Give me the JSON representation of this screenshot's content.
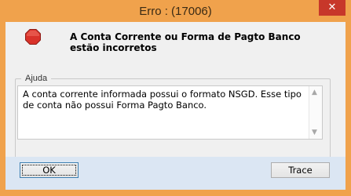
{
  "window": {
    "title": "Erro : (17006)",
    "close_glyph": "✕"
  },
  "message": "A Conta Corrente ou Forma de Pagto Banco estão incorretos",
  "help": {
    "legend": "Ajuda",
    "text": "A conta corrente informada possui o formato NSGD. Esse tipo de conta não possui Forma Pagto Banco."
  },
  "buttons": {
    "ok": "OK",
    "trace": "Trace"
  },
  "icons": {
    "error_icon": "stop-sign-icon",
    "close_icon": "close-icon",
    "scroll_up": "chevron-up-icon",
    "scroll_down": "chevron-down-icon"
  },
  "colors": {
    "titlebar": "#f0a24c",
    "close": "#c7372a",
    "stop_sign": "#d9322a",
    "footer": "#dbe6f3"
  }
}
